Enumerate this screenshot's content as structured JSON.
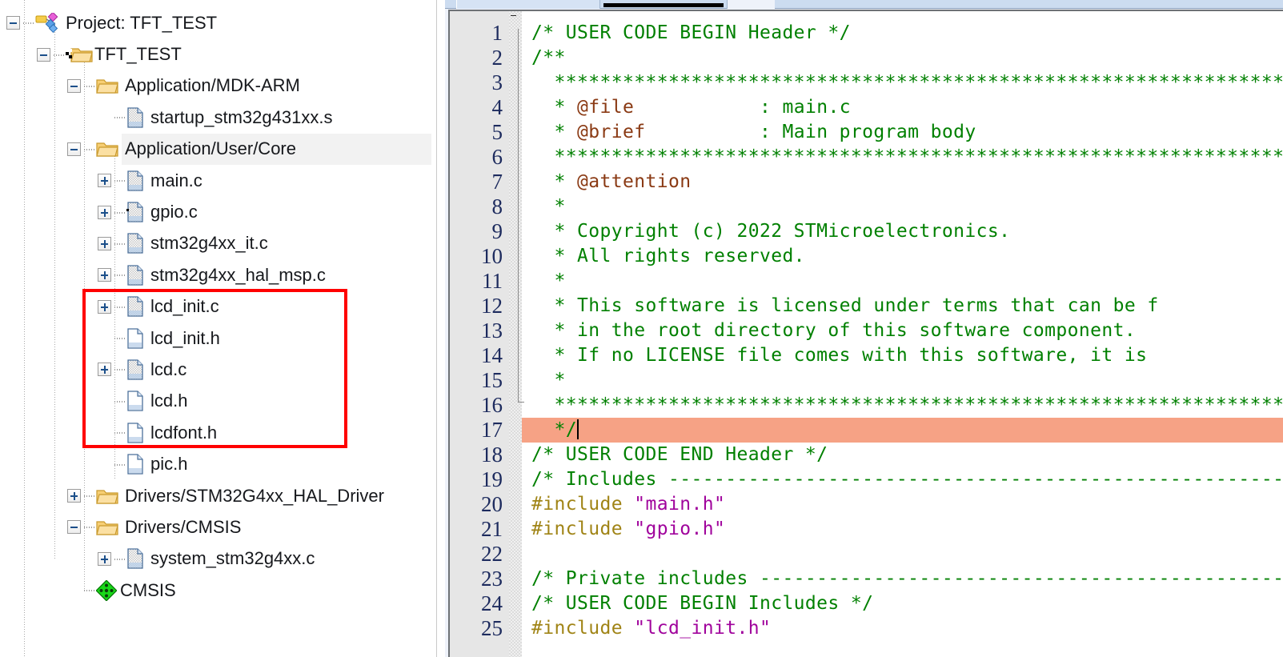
{
  "window": {
    "title": "Project: TFT_TEST"
  },
  "project_pane": {
    "name": "project-explorer",
    "tree": [
      {
        "label": "Project: TFT_TEST",
        "icon": "project-icon",
        "depth": 0,
        "toggle": "minus",
        "type": "project",
        "selected": false
      },
      {
        "label": "TFT_TEST",
        "icon": "folder-target-icon",
        "depth": 1,
        "toggle": "minus",
        "type": "target",
        "selected": false
      },
      {
        "label": "Application/MDK-ARM",
        "icon": "folder-icon",
        "depth": 2,
        "toggle": "minus",
        "type": "group",
        "selected": false
      },
      {
        "label": "startup_stm32g431xx.s",
        "icon": "file-source-icon",
        "depth": 3,
        "toggle": "none",
        "type": "file",
        "selected": false
      },
      {
        "label": "Application/User/Core",
        "icon": "folder-icon",
        "depth": 2,
        "toggle": "minus",
        "type": "group",
        "selected": true
      },
      {
        "label": "main.c",
        "icon": "file-source-icon",
        "depth": 3,
        "toggle": "plus",
        "type": "file",
        "selected": false
      },
      {
        "label": "gpio.c",
        "icon": "file-source-flag-icon",
        "depth": 3,
        "toggle": "plus",
        "type": "file",
        "selected": false
      },
      {
        "label": "stm32g4xx_it.c",
        "icon": "file-source-icon",
        "depth": 3,
        "toggle": "plus",
        "type": "file",
        "selected": false
      },
      {
        "label": "stm32g4xx_hal_msp.c",
        "icon": "file-source-icon",
        "depth": 3,
        "toggle": "plus",
        "type": "file",
        "selected": false
      },
      {
        "label": "lcd_init.c",
        "icon": "file-source-icon",
        "depth": 3,
        "toggle": "plus",
        "type": "file",
        "selected": false
      },
      {
        "label": "lcd_init.h",
        "icon": "file-header-icon",
        "depth": 3,
        "toggle": "none",
        "type": "file",
        "selected": false
      },
      {
        "label": "lcd.c",
        "icon": "file-source-icon",
        "depth": 3,
        "toggle": "plus",
        "type": "file",
        "selected": false
      },
      {
        "label": "lcd.h",
        "icon": "file-header-icon",
        "depth": 3,
        "toggle": "none",
        "type": "file",
        "selected": false
      },
      {
        "label": "lcdfont.h",
        "icon": "file-header-icon",
        "depth": 3,
        "toggle": "none",
        "type": "file",
        "selected": false
      },
      {
        "label": "pic.h",
        "icon": "file-header-icon",
        "depth": 3,
        "toggle": "none",
        "type": "file",
        "selected": false
      },
      {
        "label": "Drivers/STM32G4xx_HAL_Driver",
        "icon": "folder-icon",
        "depth": 2,
        "toggle": "plus",
        "type": "group",
        "selected": false
      },
      {
        "label": "Drivers/CMSIS",
        "icon": "folder-icon",
        "depth": 2,
        "toggle": "minus",
        "type": "group",
        "selected": false
      },
      {
        "label": "system_stm32g4xx.c",
        "icon": "file-source-icon",
        "depth": 3,
        "toggle": "plus",
        "type": "file",
        "selected": false
      },
      {
        "label": "CMSIS",
        "icon": "cmsis-diamond-icon",
        "depth": 2,
        "toggle": "none",
        "type": "component",
        "selected": false
      }
    ],
    "annotation": {
      "name": "red-highlight-box",
      "color": "#ff0000",
      "covers": [
        "lcd_init.c",
        "lcd_init.h",
        "lcd.c",
        "lcd.h",
        "lcdfont.h"
      ]
    }
  },
  "editor": {
    "name": "code-editor",
    "current_file": "main.c",
    "highlight_color": "#f6a285",
    "highlighted_line": 17,
    "gutter_text_color": "#1d2b5e",
    "syntax_colors": {
      "comment": "#008000",
      "doxygen_tag": "#8a3a14",
      "preprocessor": "#a08416",
      "string": "#a0039c"
    },
    "lines": [
      {
        "n": 1,
        "text": "/* USER CODE BEGIN Header */"
      },
      {
        "n": 2,
        "text": "/**"
      },
      {
        "n": 3,
        "text": "  ******************************************************************************"
      },
      {
        "n": 4,
        "text": "  * @file           : main.c"
      },
      {
        "n": 5,
        "text": "  * @brief          : Main program body"
      },
      {
        "n": 6,
        "text": "  ******************************************************************************"
      },
      {
        "n": 7,
        "text": "  * @attention"
      },
      {
        "n": 8,
        "text": "  *"
      },
      {
        "n": 9,
        "text": "  * Copyright (c) 2022 STMicroelectronics."
      },
      {
        "n": 10,
        "text": "  * All rights reserved."
      },
      {
        "n": 11,
        "text": "  *"
      },
      {
        "n": 12,
        "text": "  * This software is licensed under terms that can be f"
      },
      {
        "n": 13,
        "text": "  * in the root directory of this software component."
      },
      {
        "n": 14,
        "text": "  * If no LICENSE file comes with this software, it is"
      },
      {
        "n": 15,
        "text": "  *"
      },
      {
        "n": 16,
        "text": "  ******************************************************************************"
      },
      {
        "n": 17,
        "text": "  */"
      },
      {
        "n": 18,
        "text": "/* USER CODE END Header */"
      },
      {
        "n": 19,
        "text": "/* Includes ------------------------------------------------------------------"
      },
      {
        "n": 20,
        "text": "#include \"main.h\""
      },
      {
        "n": 21,
        "text": "#include \"gpio.h\""
      },
      {
        "n": 22,
        "text": ""
      },
      {
        "n": 23,
        "text": "/* Private includes ----------------------------------------------------------"
      },
      {
        "n": 24,
        "text": "/* USER CODE BEGIN Includes */"
      },
      {
        "n": 25,
        "text": "#include \"lcd_init.h\""
      }
    ]
  }
}
